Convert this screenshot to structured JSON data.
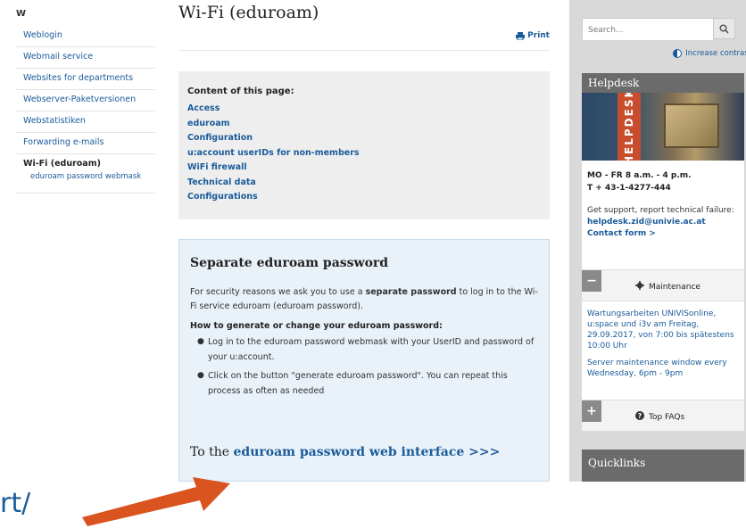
{
  "left_nav": {
    "letter": "W",
    "items": [
      {
        "label": "Weblogin"
      },
      {
        "label": "Webmail service"
      },
      {
        "label": "Websites for departments"
      },
      {
        "label": "Webserver-Paketversionen"
      },
      {
        "label": "Webstatistiken"
      },
      {
        "label": "Forwarding e-mails"
      }
    ],
    "active": "Wi-Fi (eduroam)",
    "sub_item": "eduroam password webmask"
  },
  "main": {
    "title": "Wi-Fi (eduroam)",
    "print_label": "Print",
    "toc": {
      "heading": "Content of this page:",
      "links": [
        "Access",
        "eduroam",
        "Configuration",
        "u:account userIDs for non-members",
        "WiFi firewall",
        "Technical data",
        "Configurations"
      ]
    },
    "box": {
      "heading": "Separate eduroam password",
      "para_start": "For security reasons we ask you to use a ",
      "para_bold": "separate password",
      "para_end": " to log in to the Wi-Fi service eduroam (eduroam password).",
      "subheading": "How to generate or change your eduroam password:",
      "bullets": [
        "Log in to the eduroam password webmask with your UserID and password of your u:account.",
        "Click on the button \"generate eduroam password\". You can repeat this process as often as needed"
      ],
      "cta_prefix": "To the ",
      "cta_link": "eduroam password web interface >>>"
    }
  },
  "sidebar": {
    "search_placeholder": "Search...",
    "contrast_label": "Increase contrast",
    "helpdesk": {
      "title": "Helpdesk",
      "banner": "HELPDESK",
      "hours": "MO - FR   8 a.m. - 4 p.m.",
      "phone": "T + 43-1-4277-444",
      "support": "Get support, report technical failure:",
      "email": "helpdesk.zid@univie.ac.at",
      "contact": "Contact form >"
    },
    "maintenance": {
      "toggle": "−",
      "label": "Maintenance",
      "notice1": "Wartungsarbeiten UNIVISonline, u:space und i3v am Freitag, 29.09.2017, von 7:00 bis spätestens 10:00 Uhr",
      "notice2": "Server maintenance window every Wednesday, 6pm - 9pm"
    },
    "faq": {
      "toggle": "+",
      "label": "Top FAQs"
    },
    "quicklinks_title": "Quicklinks"
  },
  "overlay": {
    "cut_text": "rt/",
    "arrow_color": "#d9541e"
  }
}
